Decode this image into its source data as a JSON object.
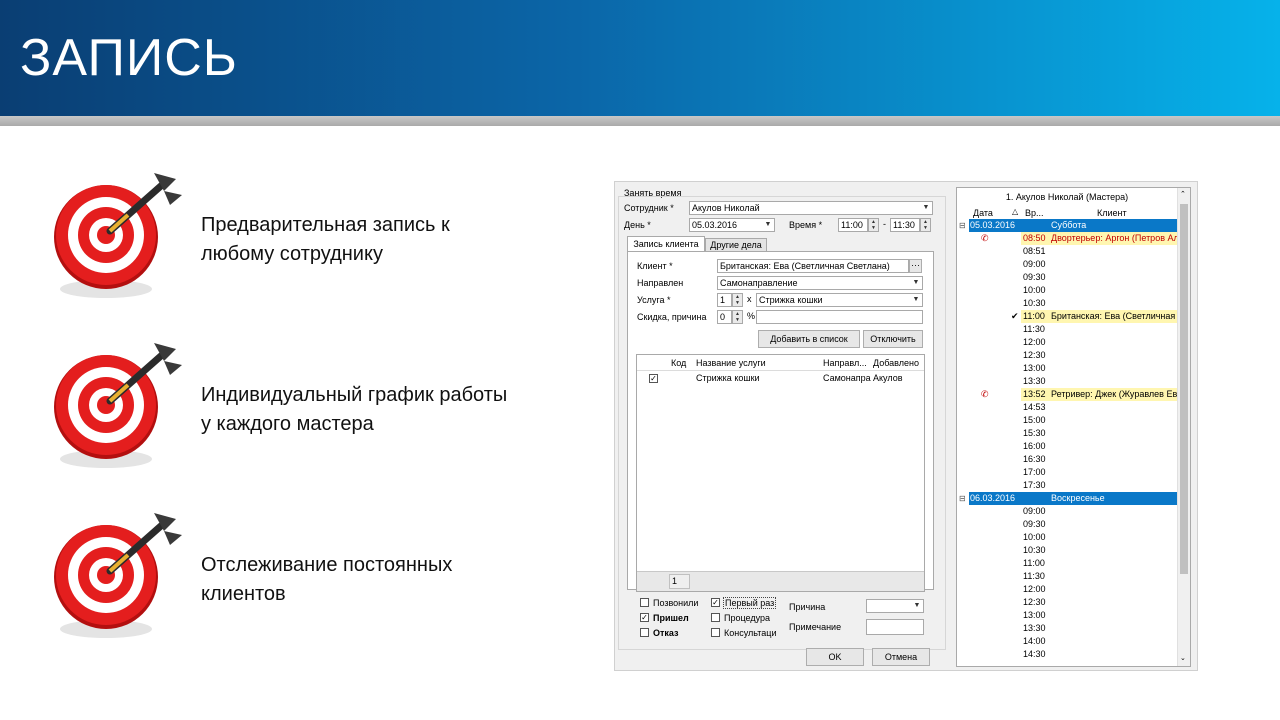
{
  "slide": {
    "title": "ЗАПИСЬ",
    "features": [
      {
        "text": "Предварительная запись к любому сотруднику",
        "icon": "target-icon"
      },
      {
        "text": "Индивидуальный график работы у каждого мастера",
        "icon": "target-icon"
      },
      {
        "text": "Отслеживание постоянных клиентов",
        "icon": "target-icon"
      }
    ]
  },
  "dialog": {
    "group_title": "Занять время",
    "employee_label": "Сотрудник *",
    "employee_value": "Акулов Николай",
    "day_label": "День *",
    "day_value": "05.03.2016",
    "time_label": "Время *",
    "time_from": "11:00",
    "time_dash": "-",
    "time_to": "11:30",
    "tabs": [
      "Запись клиента",
      "Другие дела"
    ],
    "client_label": "Клиент *",
    "client_value": "Британская: Ева (Светличная Светлана)",
    "direction_label": "Направлен",
    "direction_value": "Самонаправление",
    "service_label": "Услуга *",
    "service_qty": "1",
    "service_x": "x",
    "service_value": "Стрижка кошки",
    "discount_label": "Скидка, причина",
    "discount_value": "0",
    "discount_pct": "%",
    "add_button": "Добавить в список",
    "disable_button": "Отключить",
    "table": {
      "columns": [
        "Код",
        "Название услуги",
        "Направл...",
        "Добавлено"
      ],
      "rows": [
        {
          "checked": true,
          "code": "",
          "name": "Стрижка кошки",
          "direction": "Самонапра",
          "added": "Акулов"
        }
      ],
      "footer_count": "1"
    },
    "checks": {
      "called": {
        "label": "Позвонили",
        "checked": false
      },
      "came": {
        "label": "Пришел",
        "checked": true
      },
      "refused": {
        "label": "Отказ",
        "checked": false
      },
      "first_time": {
        "label": "Первый раз",
        "checked": true
      },
      "procedure": {
        "label": "Процедура",
        "checked": false
      },
      "consult": {
        "label": "Консультаци",
        "checked": false
      }
    },
    "reason_label": "Причина",
    "note_label": "Примечание",
    "ok_button": "OK",
    "cancel_button": "Отмена"
  },
  "schedule": {
    "title": "1. Акулов Николай (Мастера)",
    "columns": [
      "Дата",
      "Вр...",
      "Клиент"
    ],
    "days": [
      {
        "date": "05.03.2016",
        "weekday": "Суббота",
        "rows": [
          {
            "time": "08:50",
            "client": "Двортерьер: Аргон (Петров Ал",
            "style": "called"
          },
          {
            "time": "08:51",
            "client": "",
            "style": ""
          },
          {
            "time": "09:00",
            "client": "",
            "style": ""
          },
          {
            "time": "09:30",
            "client": "",
            "style": ""
          },
          {
            "time": "10:00",
            "client": "",
            "style": ""
          },
          {
            "time": "10:30",
            "client": "",
            "style": ""
          },
          {
            "time": "11:00",
            "client": "Британская: Ева (Светличная",
            "style": "came"
          },
          {
            "time": "11:30",
            "client": "",
            "style": ""
          },
          {
            "time": "12:00",
            "client": "",
            "style": ""
          },
          {
            "time": "12:30",
            "client": "",
            "style": ""
          },
          {
            "time": "13:00",
            "client": "",
            "style": ""
          },
          {
            "time": "13:30",
            "client": "",
            "style": ""
          },
          {
            "time": "13:52",
            "client": "Ретривер: Джек (Журавлев Ев",
            "style": "phone"
          },
          {
            "time": "14:53",
            "client": "",
            "style": ""
          },
          {
            "time": "15:00",
            "client": "",
            "style": ""
          },
          {
            "time": "15:30",
            "client": "",
            "style": ""
          },
          {
            "time": "16:00",
            "client": "",
            "style": ""
          },
          {
            "time": "16:30",
            "client": "",
            "style": ""
          },
          {
            "time": "17:00",
            "client": "",
            "style": ""
          },
          {
            "time": "17:30",
            "client": "",
            "style": ""
          }
        ]
      },
      {
        "date": "06.03.2016",
        "weekday": "Воскресенье",
        "rows": [
          {
            "time": "09:00",
            "client": "",
            "style": ""
          },
          {
            "time": "09:30",
            "client": "",
            "style": ""
          },
          {
            "time": "10:00",
            "client": "",
            "style": ""
          },
          {
            "time": "10:30",
            "client": "",
            "style": ""
          },
          {
            "time": "11:00",
            "client": "",
            "style": ""
          },
          {
            "time": "11:30",
            "client": "",
            "style": ""
          },
          {
            "time": "12:00",
            "client": "",
            "style": ""
          },
          {
            "time": "12:30",
            "client": "",
            "style": ""
          },
          {
            "time": "13:00",
            "client": "",
            "style": ""
          },
          {
            "time": "13:30",
            "client": "",
            "style": ""
          },
          {
            "time": "14:00",
            "client": "",
            "style": ""
          },
          {
            "time": "14:30",
            "client": "",
            "style": ""
          }
        ]
      }
    ],
    "colors": {
      "day_header": "#0a78c8",
      "highlight": "#fff6b0",
      "called_text": "#c00000"
    }
  }
}
